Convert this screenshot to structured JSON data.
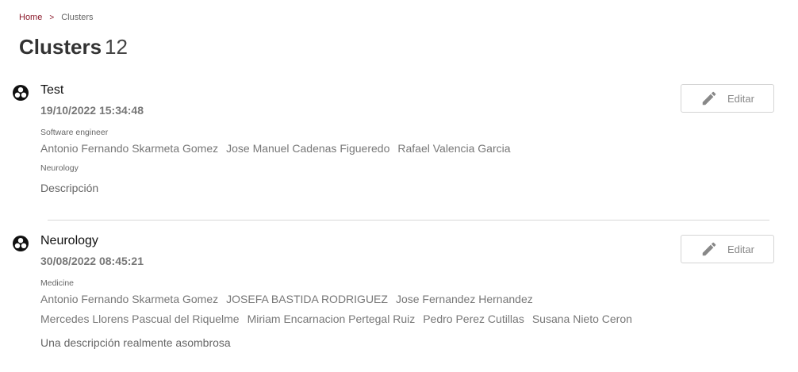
{
  "breadcrumb": {
    "home": "Home",
    "separator": ">",
    "current": "Clusters"
  },
  "header": {
    "title": "Clusters",
    "count": "12"
  },
  "clusters": [
    {
      "icon": "bubble-chart-icon",
      "name": "Test",
      "date": "19/10/2022 15:34:48",
      "category": "Software engineer",
      "members": [
        "Antonio Fernando Skarmeta Gomez",
        "Jose Manuel Cadenas Figueredo",
        "Rafael Valencia Garcia"
      ],
      "topic": "Neurology",
      "description": "Descripción",
      "edit_label": "Editar"
    },
    {
      "icon": "bubble-chart-icon",
      "name": "Neurology",
      "date": "30/08/2022 08:45:21",
      "category": "Medicine",
      "members_row1": [
        "Antonio Fernando Skarmeta Gomez",
        "JOSEFA BASTIDA RODRIGUEZ",
        "Jose Fernandez Hernandez"
      ],
      "members_row2": [
        "Mercedes Llorens Pascual del Riquelme",
        "Miriam Encarnacion Pertegal Ruiz",
        "Pedro Perez Cutillas",
        "Susana Nieto Ceron"
      ],
      "description": "Una descripción realmente asombrosa",
      "edit_label": "Editar"
    }
  ]
}
